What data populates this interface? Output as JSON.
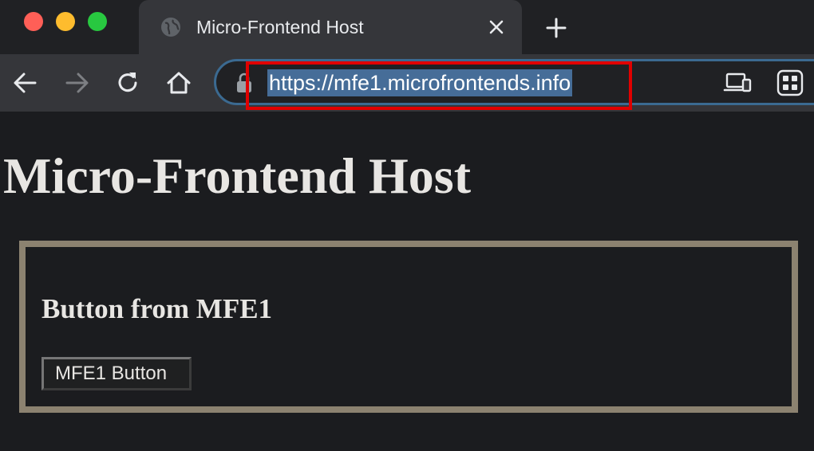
{
  "browser": {
    "tab": {
      "title": "Micro-Frontend Host",
      "favicon": "globe-icon"
    },
    "toolbar": {
      "url": "https://mfe1.microfrontends.info",
      "icons": [
        "back-arrow-icon",
        "forward-arrow-icon",
        "reload-icon",
        "home-icon",
        "lock-icon",
        "device-icon",
        "apps-grid-icon"
      ]
    },
    "colors": {
      "tab_strip": "#202124",
      "tab_active": "#35363a",
      "url_selection": "#466d98",
      "omnibox_border": "#3b6a91",
      "annotation_highlight": "#e00000"
    }
  },
  "page": {
    "title": "Micro-Frontend Host",
    "mfe": {
      "heading": "Button from MFE1",
      "button_label": "MFE1 Button"
    },
    "colors": {
      "background": "#1b1c1f",
      "text": "#e8e6e3",
      "container_border": "#8c8270"
    }
  }
}
